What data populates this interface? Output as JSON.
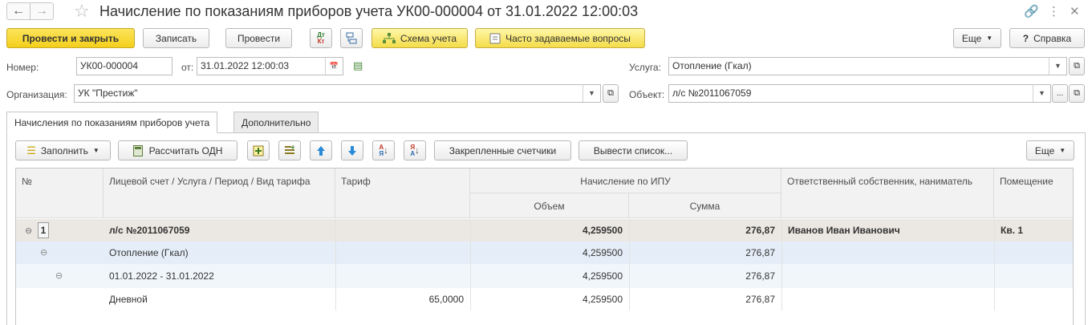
{
  "window": {
    "title": "Начисление по показаниям приборов учета УК00-000004 от 31.01.2022 12:00:03",
    "icons": {
      "back": "arrow-left-icon",
      "forward": "arrow-right-icon",
      "favorite": "star-icon",
      "link": "link-icon",
      "more": "vertical-dots-icon",
      "close": "close-icon"
    }
  },
  "toolbar": {
    "post_close": "Провести и закрыть",
    "write": "Записать",
    "post": "Провести",
    "dt_kt": "Дт Кт",
    "accounting_scheme": "Схема учета",
    "faq": "Часто задаваемые вопросы",
    "more": "Еще",
    "help": "Справка"
  },
  "form": {
    "number_label": "Номер:",
    "number_value": "УК00-000004",
    "date_label": "от:",
    "date_value": "31.01.2022 12:00:03",
    "org_label": "Организация:",
    "org_value": "УК \"Престиж\"",
    "service_label": "Услуга:",
    "service_value": "Отопление (Гкал)",
    "object_label": "Объект:",
    "object_value": "л/с №2011067059"
  },
  "tabs": [
    {
      "label": "Начисления по показаниям приборов учета",
      "active": true
    },
    {
      "label": "Дополнительно",
      "active": false
    }
  ],
  "table_toolbar": {
    "fill": "Заполнить",
    "calc_odn": "Рассчитать ОДН",
    "pinned_meters": "Закрепленные счетчики",
    "print_list": "Вывести список...",
    "more": "Еще"
  },
  "table": {
    "headers": {
      "num": "№",
      "account": "Лицевой счет / Услуга / Период / Вид тарифа",
      "tariff": "Тариф",
      "ipu": "Начисление по ИПУ",
      "volume": "Объем",
      "sum": "Сумма",
      "owner": "Ответственный собственник, наниматель",
      "premises": "Помещение"
    },
    "rows": [
      {
        "num": "1",
        "account": "л/с №2011067059",
        "tariff": "",
        "volume": "4,259500",
        "sum": "276,87",
        "owner": "Иванов Иван Иванович",
        "premises": "Кв. 1"
      },
      {
        "num": "",
        "account": "Отопление (Гкал)",
        "tariff": "",
        "volume": "4,259500",
        "sum": "276,87",
        "owner": "",
        "premises": ""
      },
      {
        "num": "",
        "account": "01.01.2022 - 31.01.2022",
        "tariff": "",
        "volume": "4,259500",
        "sum": "276,87",
        "owner": "",
        "premises": ""
      },
      {
        "num": "",
        "account": "Дневной",
        "tariff": "65,0000",
        "volume": "4,259500",
        "sum": "276,87",
        "owner": "",
        "premises": ""
      }
    ]
  }
}
